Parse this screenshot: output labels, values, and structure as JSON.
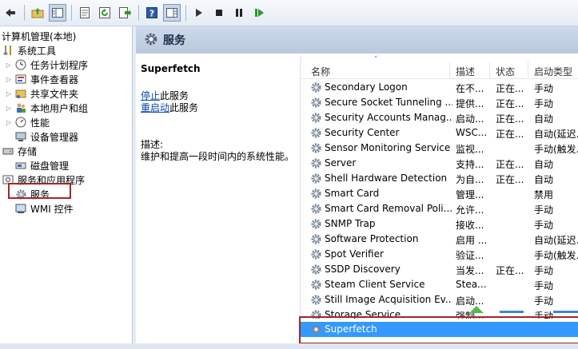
{
  "toolbar": {
    "icons": [
      "back-arrow-icon",
      "up-folder-icon",
      "show-hide-tree-icon",
      "properties-icon",
      "refresh-icon",
      "export-list-icon",
      "help-icon",
      "action-pane-icon",
      "play-icon",
      "stop-icon",
      "pause-icon",
      "restart-icon"
    ]
  },
  "tree": {
    "root": "计算机管理(本地)",
    "system_tools": "系统工具",
    "task_scheduler": "任务计划程序",
    "event_viewer": "事件查看器",
    "shared_folders": "共享文件夹",
    "local_users": "本地用户和组",
    "performance": "性能",
    "device_manager": "设备管理器",
    "storage": "存储",
    "disk_management": "磁盘管理",
    "services_apps": "服务和应用程序",
    "services": "服务",
    "wmi": "WMI 控件"
  },
  "header": {
    "title": "服务"
  },
  "extended": {
    "service_name": "Superfetch",
    "stop_link": "停止",
    "stop_suffix": "此服务",
    "restart_link": "重启动",
    "restart_suffix": "此服务",
    "desc_label": "描述:",
    "desc_text": "维护和提高一段时间内的系统性能。"
  },
  "columns": {
    "name": "名称",
    "desc": "描述",
    "status": "状态",
    "startup": "启动类型"
  },
  "rows": [
    {
      "name": "Secondary Logon",
      "desc": "在不...",
      "status": "正在...",
      "startup": "手动"
    },
    {
      "name": "Secure Socket Tunneling ...",
      "desc": "提供...",
      "status": "正在...",
      "startup": "手动"
    },
    {
      "name": "Security Accounts Manag...",
      "desc": "启动...",
      "status": "正在...",
      "startup": "自动"
    },
    {
      "name": "Security Center",
      "desc": "WSC...",
      "status": "正在...",
      "startup": "自动(延迟..."
    },
    {
      "name": "Sensor Monitoring Service",
      "desc": "监视...",
      "status": "",
      "startup": "手动(触发..."
    },
    {
      "name": "Server",
      "desc": "支持...",
      "status": "正在...",
      "startup": "自动"
    },
    {
      "name": "Shell Hardware Detection",
      "desc": "为自...",
      "status": "正在...",
      "startup": "自动"
    },
    {
      "name": "Smart Card",
      "desc": "管理...",
      "status": "",
      "startup": "禁用"
    },
    {
      "name": "Smart Card Removal Poli...",
      "desc": "允许...",
      "status": "",
      "startup": "手动"
    },
    {
      "name": "SNMP Trap",
      "desc": "接收...",
      "status": "",
      "startup": "手动"
    },
    {
      "name": "Software Protection",
      "desc": "启用 ...",
      "status": "",
      "startup": "自动(延迟..."
    },
    {
      "name": "Spot Verifier",
      "desc": "验证...",
      "status": "",
      "startup": "手动(触发..."
    },
    {
      "name": "SSDP Discovery",
      "desc": "当发...",
      "status": "正在...",
      "startup": "手动"
    },
    {
      "name": "Steam Client Service",
      "desc": "Stea...",
      "status": "",
      "startup": "手动"
    },
    {
      "name": "Still Image Acquisition Ev...",
      "desc": "启动...",
      "status": "",
      "startup": "手动"
    },
    {
      "name": "Storage Service",
      "desc": "强制...",
      "status": "",
      "startup": "手动"
    },
    {
      "name": "Superfetch",
      "desc": "",
      "status": "",
      "startup": ""
    }
  ],
  "colors": {
    "selection": "#3399ff",
    "highlight_border": "#a32626",
    "header_band": "#c4d3e6"
  }
}
